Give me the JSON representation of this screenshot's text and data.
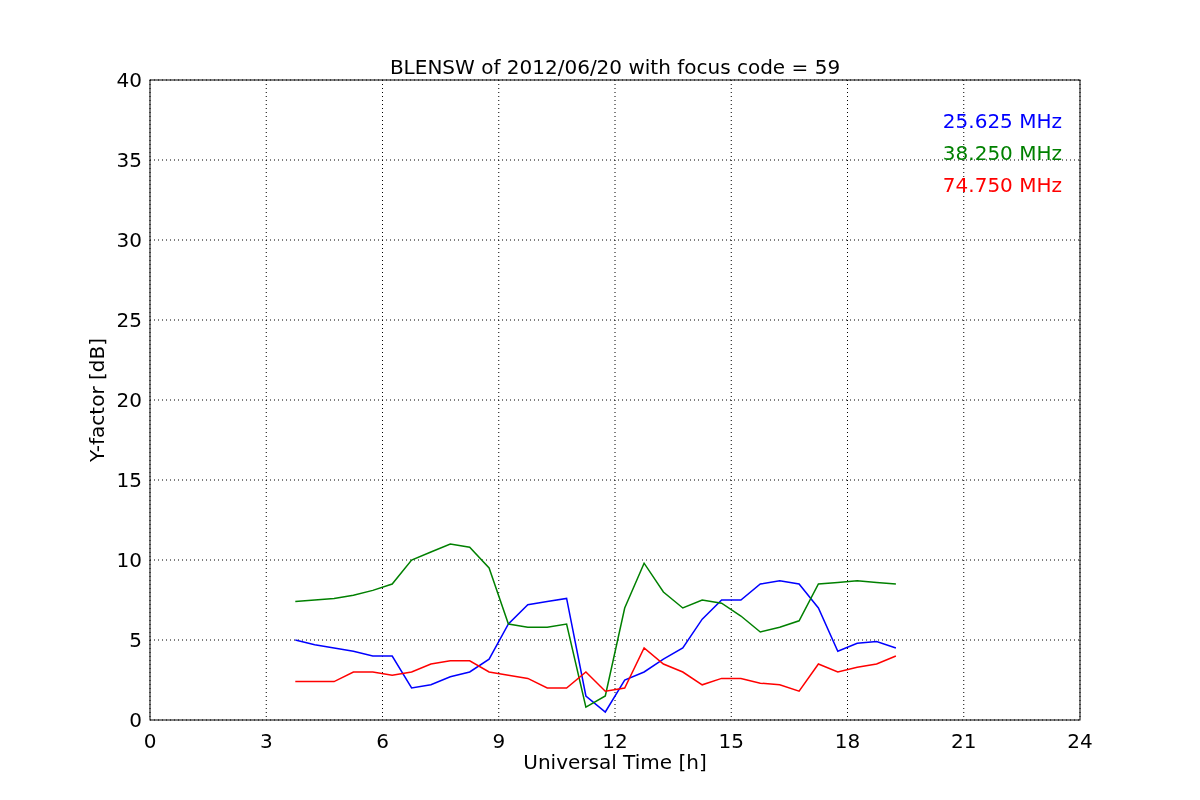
{
  "chart_data": {
    "type": "line",
    "title": "BLENSW of 2012/06/20 with focus code = 59",
    "xlabel": "Universal Time [h]",
    "ylabel": "Y-factor [dB]",
    "x": [
      3.75,
      4.25,
      4.75,
      5.25,
      5.75,
      6.25,
      6.75,
      7.25,
      7.75,
      8.25,
      8.75,
      9.25,
      9.75,
      10.25,
      10.75,
      11.25,
      11.75,
      12.25,
      12.75,
      13.25,
      13.75,
      14.25,
      14.75,
      15.25,
      15.75,
      16.25,
      16.75,
      17.25,
      17.75,
      18.25,
      18.75,
      19.25
    ],
    "series": [
      {
        "name": "25.625 MHz",
        "color": "#0000ff",
        "values": [
          5,
          4.7,
          4.5,
          4.3,
          4,
          4,
          2,
          2.2,
          2.7,
          3,
          3.8,
          6,
          7.2,
          7.4,
          7.6,
          1.5,
          0.5,
          2.5,
          3,
          3.8,
          4.5,
          6.3,
          7.5,
          7.5,
          8.5,
          8.7,
          8.5,
          7,
          4.3,
          4.8,
          4.9,
          4.5
        ]
      },
      {
        "name": "38.250 MHz",
        "color": "#008000",
        "values": [
          7.4,
          7.5,
          7.6,
          7.8,
          8.1,
          8.5,
          10,
          10.5,
          11,
          10.8,
          9.5,
          6,
          5.8,
          5.8,
          6,
          0.8,
          1.5,
          7,
          9.8,
          8,
          7,
          7.5,
          7.3,
          6.5,
          5.5,
          5.8,
          6.2,
          8.5,
          8.6,
          8.7,
          8.6,
          8.5
        ]
      },
      {
        "name": "74.750 MHz",
        "color": "#ff0000",
        "values": [
          2.4,
          2.4,
          2.4,
          3,
          3,
          2.8,
          3,
          3.5,
          3.7,
          3.7,
          3,
          2.8,
          2.6,
          2,
          2,
          3,
          1.8,
          2,
          4.5,
          3.5,
          3,
          2.2,
          2.6,
          2.6,
          2.3,
          2.2,
          1.8,
          3.5,
          3,
          3.3,
          3.5,
          4
        ]
      }
    ],
    "xlim": [
      0,
      24
    ],
    "ylim": [
      0,
      40
    ],
    "xticks": [
      0,
      3,
      6,
      9,
      12,
      15,
      18,
      21,
      24
    ],
    "yticks": [
      0,
      5,
      10,
      15,
      20,
      25,
      30,
      35,
      40
    ],
    "grid": true
  }
}
